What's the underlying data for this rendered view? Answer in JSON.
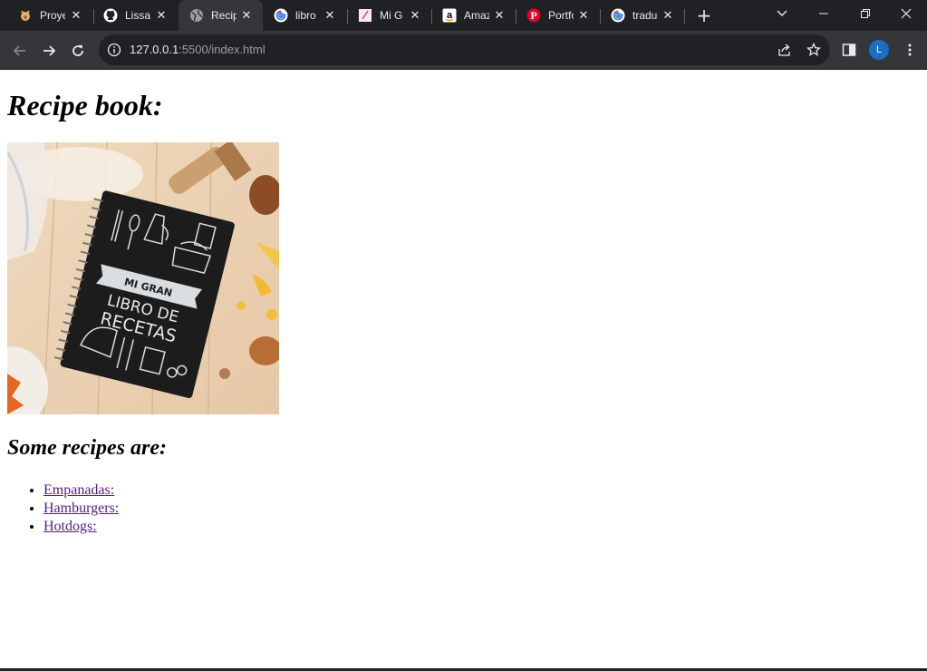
{
  "browser": {
    "tabs": [
      {
        "title": "Proyecto",
        "icon": "pig-icon"
      },
      {
        "title": "Lissa",
        "icon": "github-icon"
      },
      {
        "title": "Recipe book",
        "icon": "globe-icon",
        "active": true
      },
      {
        "title": "libro",
        "icon": "google-icon"
      },
      {
        "title": "Mi G",
        "icon": "note-icon"
      },
      {
        "title": "Amazon",
        "icon": "amazon-icon"
      },
      {
        "title": "Portfolio",
        "icon": "pinterest-icon"
      },
      {
        "title": "traductor",
        "icon": "google-icon"
      }
    ],
    "url_host": "127.0.0.1",
    "url_rest": ":5500/index.html",
    "profile_initial": "L"
  },
  "page": {
    "heading": "Recipe book:",
    "image_text_line1": "MI GRAN",
    "image_text_line2": "LIBRO DE",
    "image_text_line3": "RECETAS",
    "subheading": "Some recipes are:",
    "recipes": [
      "Empanadas:",
      "Hamburgers:",
      "Hotdogs:"
    ]
  },
  "colors": {
    "tabstrip": "#202124",
    "toolbar": "#35363a",
    "link_visited": "#551a8b"
  }
}
